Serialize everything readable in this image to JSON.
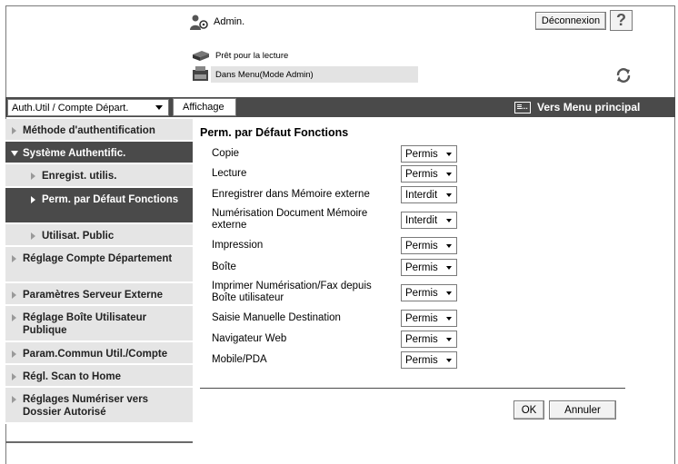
{
  "header": {
    "user": "Admin.",
    "status_ready": "Prêt pour la lecture",
    "status_menu": "Dans Menu(Mode Admin)",
    "logout_label": "Déconnexion",
    "help_label": "?"
  },
  "toolbar": {
    "auth_select_value": "Auth.Util / Compte Départ.",
    "affichage_label": "Affichage",
    "main_menu_label": "Vers Menu principal"
  },
  "sidebar": {
    "items": [
      {
        "label": "Méthode d'authentification"
      },
      {
        "label": "Système Authentific."
      },
      {
        "label": "Enregist. utilis."
      },
      {
        "label": "Perm. par Défaut Fonctions"
      },
      {
        "label": "Utilisat. Public"
      },
      {
        "label": "Réglage Compte Département"
      },
      {
        "label": "Paramètres Serveur Externe"
      },
      {
        "label": "Réglage Boîte Utilisateur Publique"
      },
      {
        "label": "Param.Commun Util./Compte"
      },
      {
        "label": "Régl. Scan to Home"
      },
      {
        "label": "Réglages Numériser vers Dossier Autorisé"
      }
    ]
  },
  "content": {
    "title": "Perm. par Défaut Fonctions",
    "rows": [
      {
        "label": "Copie",
        "value": "Permis"
      },
      {
        "label": "Lecture",
        "value": "Permis"
      },
      {
        "label": "Enregistrer dans Mémoire externe",
        "value": "Interdit"
      },
      {
        "label": "Numérisation Document Mémoire externe",
        "value": "Interdit"
      },
      {
        "label": "Impression",
        "value": "Permis"
      },
      {
        "label": "Boîte",
        "value": "Permis"
      },
      {
        "label": "Imprimer Numérisation/Fax depuis Boîte utilisateur",
        "value": "Permis"
      },
      {
        "label": "Saisie Manuelle Destination",
        "value": "Permis"
      },
      {
        "label": "Navigateur Web",
        "value": "Permis"
      },
      {
        "label": "Mobile/PDA",
        "value": "Permis"
      }
    ],
    "ok_label": "OK",
    "cancel_label": "Annuler"
  },
  "icons": {
    "admin": "admin-user-icon",
    "ready": "scanner-icon",
    "menu": "printer-icon",
    "refresh": "refresh-icon",
    "main_menu": "main-menu-icon"
  },
  "colors": {
    "dark_bar": "#4a4a4a",
    "sidebar_bg": "#e5e5e5",
    "status_bar": "#e3e3e3"
  }
}
